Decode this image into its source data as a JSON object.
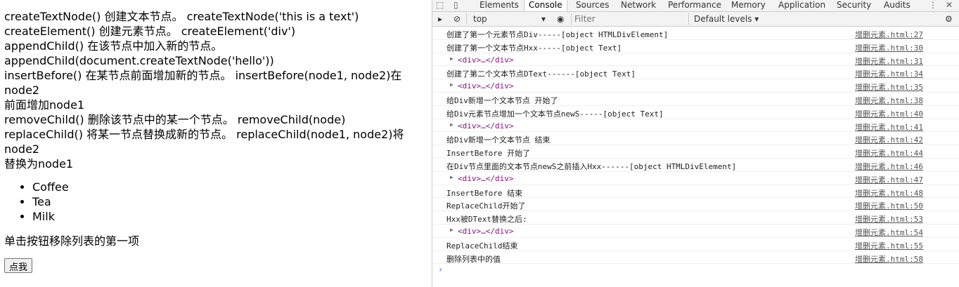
{
  "page": {
    "methods": [
      "createTextNode() 创建文本节点。 createTextNode('this is a text')",
      "createElement() 创建元素节点。 createElement('div')",
      "appendChild() 在该节点中加入新的节点。",
      "appendChild(document.createTextNode('hello'))",
      "insertBefore() 在某节点前面增加新的节点。 insertBefore(node1, node2)在node2",
      "前面增加node1",
      "removeChild() 删除该节点中的某一个节点。 removeChild(node)",
      "replaceChild() 将某一节点替换成新的节点。 replaceChild(node1, node2)将node2",
      "替换为node1"
    ],
    "list": [
      "Coffee",
      "Tea",
      "Milk"
    ],
    "instruction": "单击按钮移除列表的第一项",
    "button_label": "点我"
  },
  "devtools": {
    "tabs": [
      "Elements",
      "Console",
      "Sources",
      "Network",
      "Performance",
      "Memory",
      "Application",
      "Security",
      "Audits"
    ],
    "active_tab": "Console",
    "toolbar": {
      "context": "top",
      "filter_placeholder": "Filter",
      "levels": "Default levels ▾"
    },
    "logs": [
      {
        "text": "创建了第一个元素节点Div-----[object HTMLDivElement]",
        "src": "增删元素.html:27",
        "kind": "log"
      },
      {
        "text": "创建了第一个文本节点Hxx-----[object Text]",
        "src": "增删元素.html:30",
        "kind": "log"
      },
      {
        "text": "<div>…</div>",
        "src": "增删元素.html:31",
        "kind": "el"
      },
      {
        "text": "创建了第二个文本节点DText------[object Text]",
        "src": "增删元素.html:34",
        "kind": "log"
      },
      {
        "text": "<div>…</div>",
        "src": "增删元素.html:35",
        "kind": "el"
      },
      {
        "text": "给Div新增一个文本节点 开始了",
        "src": "增删元素.html:38",
        "kind": "log"
      },
      {
        "text": "给Div元素节点增加一个文本节点newS-----[object Text]",
        "src": "增删元素.html:40",
        "kind": "log"
      },
      {
        "text": "<div>…</div>",
        "src": "增删元素.html:41",
        "kind": "el"
      },
      {
        "text": "给Div新增一个文本节点 结束",
        "src": "增删元素.html:42",
        "kind": "log"
      },
      {
        "text": "InsertBefore 开始了",
        "src": "增删元素.html:44",
        "kind": "log"
      },
      {
        "text": "在Div节点里面的文本节点newS之前插入Hxx------[object HTMLDivElement]",
        "src": "增删元素.html:46",
        "kind": "log"
      },
      {
        "text": "<div>…</div>",
        "src": "增删元素.html:47",
        "kind": "el"
      },
      {
        "text": "InsertBefore 结束",
        "src": "增删元素.html:48",
        "kind": "log"
      },
      {
        "text": "ReplaceChild开始了",
        "src": "增删元素.html:50",
        "kind": "log"
      },
      {
        "text": "Hxx被DText替换之后:",
        "src": "增删元素.html:53",
        "kind": "log"
      },
      {
        "text": "<div>…</div>",
        "src": "增删元素.html:54",
        "kind": "el"
      },
      {
        "text": "ReplaceChild结束",
        "src": "增删元素.html:55",
        "kind": "log"
      },
      {
        "text": "删除列表中的值",
        "src": "增删元素.html:58",
        "kind": "log"
      }
    ],
    "prompt_symbol": "›"
  }
}
